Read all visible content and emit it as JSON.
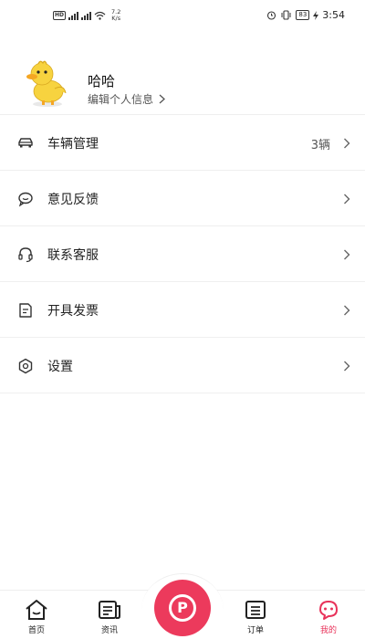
{
  "status_bar": {
    "left_badge": "HD",
    "network_speed_value": "7.2",
    "network_speed_unit": "K/s",
    "battery": "83",
    "time": "3:54"
  },
  "profile": {
    "name": "哈哈",
    "edit_label": "编辑个人信息"
  },
  "menu": {
    "items": [
      {
        "icon": "car-icon",
        "label": "车辆管理",
        "value": "3辆"
      },
      {
        "icon": "chat-icon",
        "label": "意见反馈",
        "value": ""
      },
      {
        "icon": "headset-icon",
        "label": "联系客服",
        "value": ""
      },
      {
        "icon": "invoice-icon",
        "label": "开具发票",
        "value": ""
      },
      {
        "icon": "settings-hex-icon",
        "label": "设置",
        "value": ""
      }
    ]
  },
  "bottom_nav": {
    "items": [
      {
        "icon": "home-icon",
        "label": "首页",
        "active": false
      },
      {
        "icon": "news-icon",
        "label": "资讯",
        "active": false
      },
      {
        "icon": "parking-icon",
        "label": "P",
        "active": false
      },
      {
        "icon": "orders-icon",
        "label": "订单",
        "active": false
      },
      {
        "icon": "profile-face-icon",
        "label": "我的",
        "active": true
      }
    ],
    "accent_color": "#e8325a"
  }
}
